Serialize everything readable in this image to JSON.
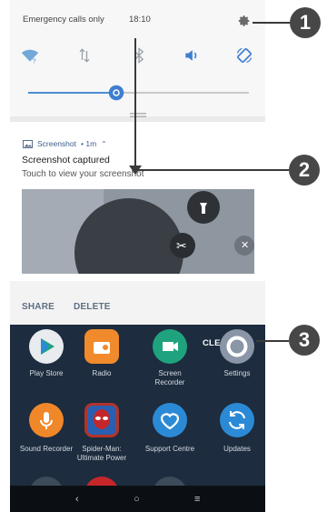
{
  "status_bar": {
    "carrier_text": "Emergency calls only",
    "time": "18:10"
  },
  "quick_settings": {
    "tiles": [
      {
        "name": "wifi-icon",
        "color": "#5b9bd5"
      },
      {
        "name": "data-icon",
        "color": "#9aa0a6"
      },
      {
        "name": "bluetooth-icon",
        "color": "#9aa0a6"
      },
      {
        "name": "sound-icon",
        "color": "#3f7fd0"
      },
      {
        "name": "auto-rotate-icon",
        "color": "#3f7fd0"
      }
    ],
    "brightness_level": 0.4
  },
  "notification": {
    "app_name": "Screenshot",
    "meta": "• 1m",
    "title": "Screenshot captured",
    "text": "Touch to view your screenshot",
    "actions": [
      "SHARE",
      "DELETE"
    ]
  },
  "recents": {
    "clear_all_label": "CLEAR ALL"
  },
  "apps": [
    {
      "label": "Play Store",
      "color": "#e8ecef"
    },
    {
      "label": "Radio",
      "color": "#f08a2b"
    },
    {
      "label": "Screen\nRecorder",
      "color": "#1fa37e"
    },
    {
      "label": "Settings",
      "color": "#8a96a8"
    },
    {
      "label": "Sound Recorder",
      "color": "#f0882a"
    },
    {
      "label": "Spider-Man:\nUltimate Power",
      "color": "#b3332a"
    },
    {
      "label": "Support Centre",
      "color": "#2b8ad6"
    },
    {
      "label": "Updates",
      "color": "#2b8ad6"
    }
  ],
  "navigation": [
    "back-icon",
    "home-icon",
    "recents-icon"
  ],
  "callouts": [
    "1",
    "2",
    "3"
  ],
  "colors": {
    "accent": "#4a8fd6",
    "callout": "#474747"
  }
}
